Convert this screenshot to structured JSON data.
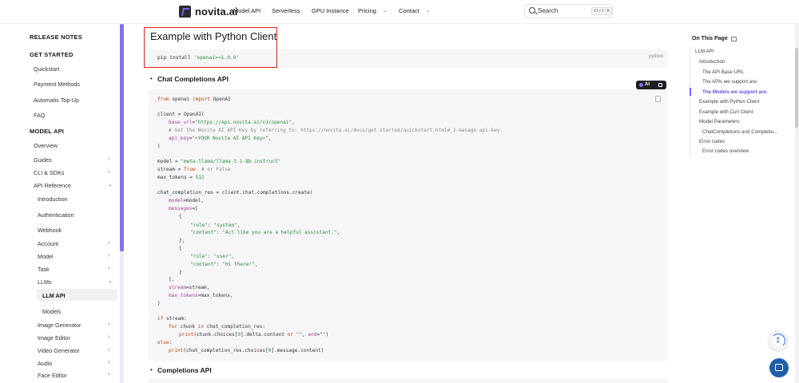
{
  "header": {
    "brand": "novita.ai",
    "nav": [
      {
        "label": "Model API",
        "has_chevron": false
      },
      {
        "label": "Serverless",
        "has_chevron": false
      },
      {
        "label": "GPU Instance",
        "has_chevron": false
      },
      {
        "label": "Pricing",
        "has_chevron": true
      },
      {
        "label": "Contact",
        "has_chevron": true
      }
    ],
    "search": {
      "placeholder": "Search",
      "key1": "Ctrl",
      "key2": "K"
    }
  },
  "sidebar": {
    "release_notes": "RELEASE NOTES",
    "get_started": "GET STARTED",
    "get_started_items": [
      "Quickstart",
      "Payment Methods",
      "Automatic Top-Up",
      "FAQ"
    ],
    "model_api": "MODEL API",
    "overview": "Overview",
    "guides": "Guides",
    "cli_sdks": "CLI & SDKs",
    "api_reference": "API Reference",
    "api_ref_items": [
      "Introduction",
      "Authentication",
      "Webhook"
    ],
    "account": "Account",
    "model": "Model",
    "task": "Task",
    "llms": "LLMs",
    "llm_api": "LLM API",
    "models": "Models",
    "image_generator": "Image Generator",
    "image_editor": "Image Editor",
    "video_generator": "Video Generator",
    "audio": "Audio",
    "face_editor": "Face Editor"
  },
  "main": {
    "section_title": "Example with Python Client",
    "pip_cmd": "pip install ",
    "pip_pkg": "'openai>=1.0.0'",
    "pip_lang": "python",
    "chat_heading": "Chat Completions API",
    "completions_heading": "Completions API",
    "ai_badge": "AI",
    "code": {
      "l1_kw1": "from",
      "l1_mid": " openai ",
      "l1_kw2": "import",
      "l1_end": " OpenAI",
      "l2": "client = OpenAI(",
      "l3_arg": "base_url",
      "l3_eq": "=",
      "l3_str": "\"https://api.novita.ai/v3/openai\"",
      "l3_end": ",",
      "l4_cm": "# Get the Novita AI API Key by referring to: https://novita.ai/docs/get-started/quickstart.html#_2-manage-api-key.",
      "l5_arg": "api_key",
      "l5_eq": "=",
      "l5_str": "\"<YOUR Novita AI API Key>\"",
      "l5_end": ",",
      "l6": ")",
      "l7_pre": "model = ",
      "l7_str": "\"meta-llama/llama-3.1-8b-instruct\"",
      "l8_pre": "stream = ",
      "l8_kw": "True",
      "l8_cm": "  # or False",
      "l9_pre": "max_tokens = ",
      "l9_num": "512",
      "l10": "chat_completion_res = client.chat.completions.create(",
      "l11_arg": "model",
      "l11_end": "=model,",
      "l12_arg": "messages",
      "l12_end": "=[",
      "l13": "{",
      "l14_str1": "\"role\"",
      "l14_mid": ": ",
      "l14_str2": "\"system\"",
      "l14_end": ",",
      "l15_str1": "\"content\"",
      "l15_mid": ": ",
      "l15_str2": "\"Act like you are a helpful assistant.\"",
      "l15_end": ",",
      "l16": "},",
      "l17": "{",
      "l18_str1": "\"role\"",
      "l18_mid": ": ",
      "l18_str2": "\"user\"",
      "l18_end": ",",
      "l19_str1": "\"content\"",
      "l19_mid": ": ",
      "l19_str2": "\"Hi there!\"",
      "l19_end": ",",
      "l20": "}",
      "l21": "],",
      "l22_arg": "stream",
      "l22_end": "=stream,",
      "l23_arg": "max_tokens",
      "l23_end": "=max_tokens,",
      "l24": ")",
      "l25_kw": "if",
      "l25_end": " stream:",
      "l26_kw1": "for",
      "l26_mid": " chunk ",
      "l26_kw2": "in",
      "l26_end": " chat_completion_res:",
      "l27_fn": "print",
      "l27_a": "(chunk.choices[",
      "l27_n": "0",
      "l27_b": "].delta.content ",
      "l27_kw": "or",
      "l27_c": " ",
      "l27_s1": "\"\"",
      "l27_d": ", ",
      "l27_arg": "end",
      "l27_e": "=",
      "l27_s2": "\"\"",
      "l27_f": ")",
      "l28_kw": "else",
      "l28_end": ":",
      "l29_fn": "print",
      "l29_a": "(chat_completion_res.choices[",
      "l29_n": "0",
      "l29_b": "].message.content)"
    }
  },
  "toc": {
    "title": "On This Page",
    "items": [
      {
        "label": "LLM API",
        "level": 0,
        "active": false
      },
      {
        "label": "Introduction",
        "level": 1,
        "active": false
      },
      {
        "label": "The API Base URL",
        "level": 2,
        "active": false
      },
      {
        "label": "The APIs we support are:",
        "level": 2,
        "active": false
      },
      {
        "label": "The Models we support are:",
        "level": 2,
        "active": true
      },
      {
        "label": "Example with Python Client",
        "level": 1,
        "active": false
      },
      {
        "label": "Example with Curl Client",
        "level": 1,
        "active": false
      },
      {
        "label": "Model Parameters",
        "level": 1,
        "active": false
      },
      {
        "label": "ChatCompletions and Completio...",
        "level": 2,
        "active": false
      },
      {
        "label": "Error codes",
        "level": 1,
        "active": false
      },
      {
        "label": "Error codes overview",
        "level": 2,
        "active": false
      }
    ]
  },
  "colors": {
    "accent": "#7c5cff",
    "highlight_border": "#e11d1d",
    "string": "#2d8a3e",
    "keyword": "#c2410c",
    "argument": "#a1439a",
    "comment": "#8a8a8a",
    "chat_button": "#1f5fa8"
  },
  "icons": [
    "logo-icon",
    "search-icon",
    "chevron-down-icon",
    "chevron-right-icon",
    "printer-icon",
    "copy-icon",
    "back-to-top-icon",
    "chat-icon"
  ]
}
